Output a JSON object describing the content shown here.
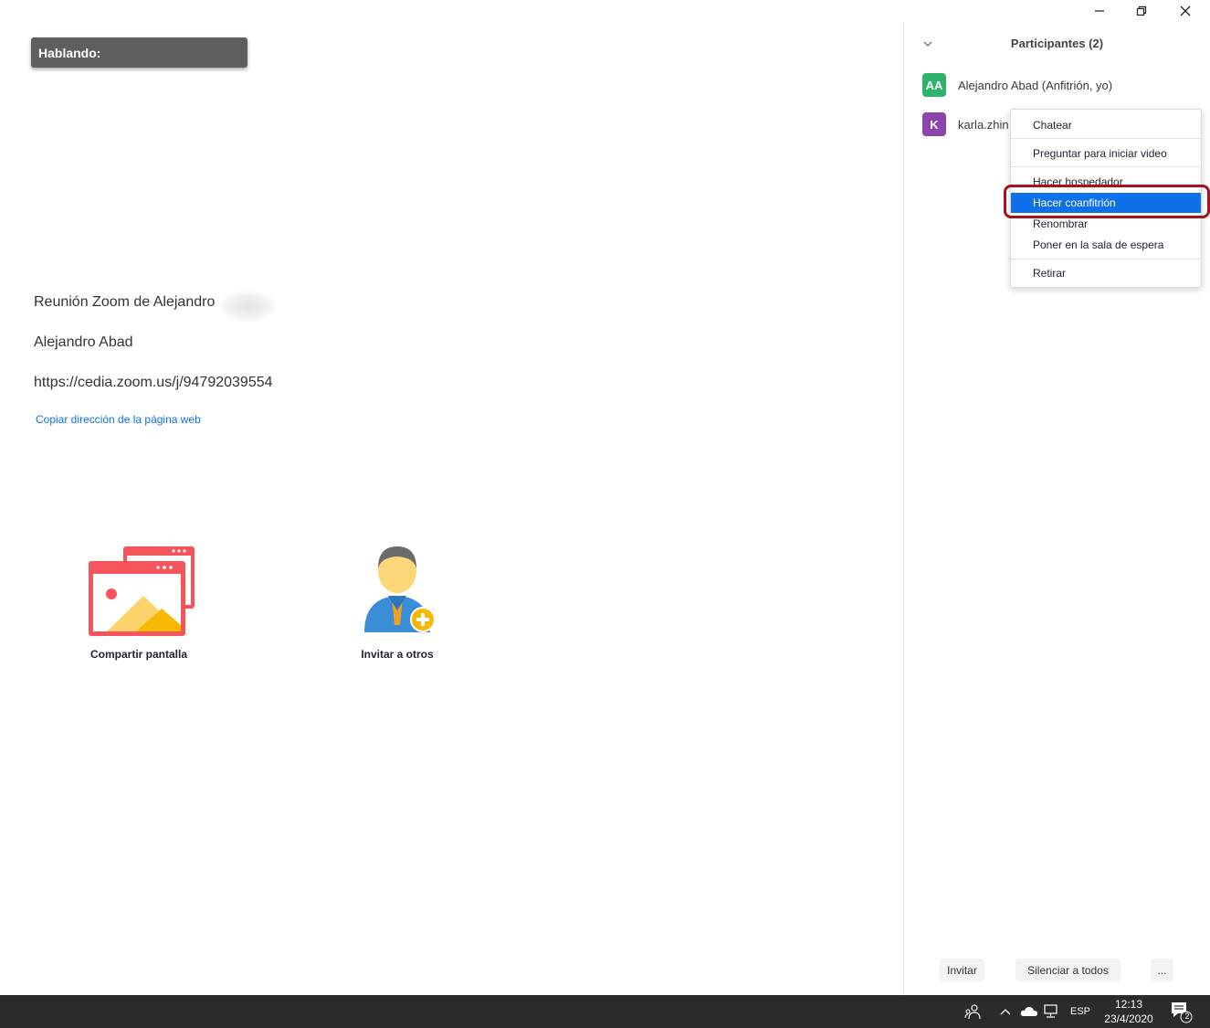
{
  "window": {
    "minimize_icon": "minimize-icon",
    "maximize_icon": "restore-icon",
    "close_icon": "close-icon"
  },
  "main": {
    "speaking_label": "Hablando:",
    "meeting_title": "Reunión Zoom de Alejandro",
    "host_name": "Alejandro Abad",
    "meeting_url": "https://cedia.zoom.us/j/94792039554",
    "copy_link_label": "Copiar dirección de la página web",
    "actions": {
      "share_label": "Compartir pantalla",
      "invite_label": "Invitar a otros"
    }
  },
  "participants_panel": {
    "title": "Participantes (2)",
    "participants": [
      {
        "initials": "AA",
        "name": "Alejandro Abad (Anfitrión, yo)",
        "color": "#2fb36b"
      },
      {
        "initials": "K",
        "name": "karla.zhin",
        "color": "#8e44ad"
      }
    ],
    "context_menu": {
      "items": [
        "Chatear",
        "Preguntar para iniciar video",
        "Hacer hospedador",
        "Hacer coanfitrión",
        "Renombrar",
        "Poner en la sala de espera",
        "Retirar"
      ],
      "highlighted": "Hacer coanfitrión",
      "highlight_color": "#0e71eb"
    },
    "footer": {
      "invite_label": "Invitar",
      "mute_all_label": "Silenciar a todos",
      "more_label": "..."
    }
  },
  "taskbar": {
    "language": "ESP",
    "time": "12:13",
    "date": "23/4/2020",
    "notification_count": "2"
  },
  "colors": {
    "accent": "#0e71eb",
    "highlight_outline": "#a5141a",
    "taskbar": "#2b2b2b"
  }
}
